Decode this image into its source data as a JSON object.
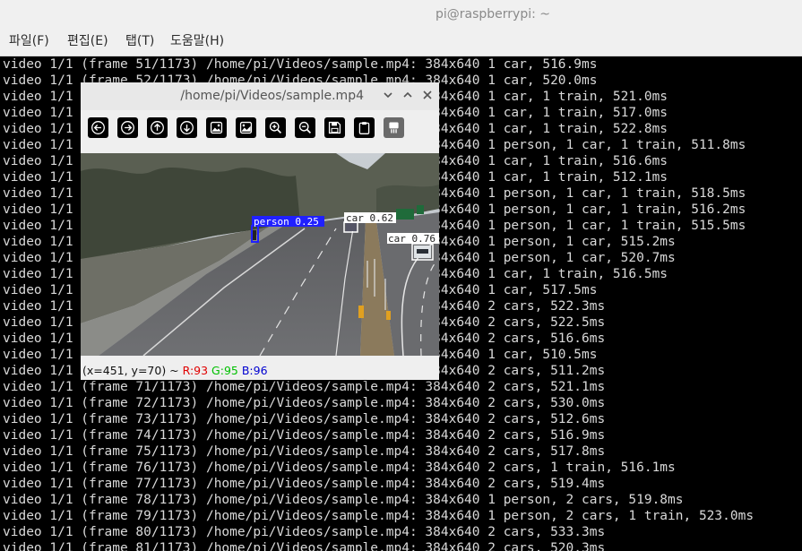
{
  "window": {
    "title": "pi@raspberrypi: ~"
  },
  "menu": [
    "파일(F)",
    "편집(E)",
    "탭(T)",
    "도움말(H)"
  ],
  "terminal_lines": [
    "video 1/1 (frame 51/1173) /home/pi/Videos/sample.mp4: 384x640 1 car, 516.9ms",
    "video 1/1 (frame 52/1173) /home/pi/Videos/sample.mp4: 384x640 1 car, 520.0ms",
    "video 1/1                                             384x640 1 car, 1 train, 521.0ms",
    "video 1/1                                             384x640 1 car, 1 train, 517.0ms",
    "video 1/1                                             384x640 1 car, 1 train, 522.8ms",
    "video 1/1                                             384x640 1 person, 1 car, 1 train, 511.8ms",
    "video 1/1                                             384x640 1 car, 1 train, 516.6ms",
    "video 1/1                                             384x640 1 car, 1 train, 512.1ms",
    "video 1/1                                             384x640 1 person, 1 car, 1 train, 518.5ms",
    "video 1/1                                             384x640 1 person, 1 car, 1 train, 516.2ms",
    "video 1/1                                             384x640 1 person, 1 car, 1 train, 515.5ms",
    "video 1/1                                             384x640 1 person, 1 car, 515.2ms",
    "video 1/1                                             384x640 1 person, 1 car, 520.7ms",
    "video 1/1                                             384x640 1 car, 1 train, 516.5ms",
    "video 1/1                                             384x640 1 car, 517.5ms",
    "video 1/1                                             384x640 2 cars, 522.3ms",
    "video 1/1                                             384x640 2 cars, 522.5ms",
    "video 1/1                                             384x640 2 cars, 516.6ms",
    "video 1/1                                             384x640 1 car, 510.5ms",
    "video 1/1                                             384x640 2 cars, 511.2ms",
    "video 1/1 (frame 71/1173) /home/pi/Videos/sample.mp4: 384x640 2 cars, 521.1ms",
    "video 1/1 (frame 72/1173) /home/pi/Videos/sample.mp4: 384x640 2 cars, 530.0ms",
    "video 1/1 (frame 73/1173) /home/pi/Videos/sample.mp4: 384x640 2 cars, 512.6ms",
    "video 1/1 (frame 74/1173) /home/pi/Videos/sample.mp4: 384x640 2 cars, 516.9ms",
    "video 1/1 (frame 75/1173) /home/pi/Videos/sample.mp4: 384x640 2 cars, 517.8ms",
    "video 1/1 (frame 76/1173) /home/pi/Videos/sample.mp4: 384x640 2 cars, 1 train, 516.1ms",
    "video 1/1 (frame 77/1173) /home/pi/Videos/sample.mp4: 384x640 2 cars, 519.4ms",
    "video 1/1 (frame 78/1173) /home/pi/Videos/sample.mp4: 384x640 1 person, 2 cars, 519.8ms",
    "video 1/1 (frame 79/1173) /home/pi/Videos/sample.mp4: 384x640 1 person, 2 cars, 1 train, 523.0ms",
    "video 1/1 (frame 80/1173) /home/pi/Videos/sample.mp4: 384x640 2 cars, 533.3ms",
    "video 1/1 (frame 81/1173) /home/pi/Videos/sample.mp4: 384x640 2 cars, 520.3ms"
  ],
  "viewer": {
    "title": "/home/pi/Videos/sample.mp4",
    "toolbar_icons": [
      "arrow-left-icon",
      "arrow-right-icon",
      "arrow-up-icon",
      "arrow-down-icon",
      "image-icon",
      "image-settings-icon",
      "zoom-in-icon",
      "zoom-out-icon",
      "save-icon",
      "clipboard-icon",
      "properties-icon"
    ],
    "detections": [
      {
        "label": "person 0.25",
        "color": "#2020ff"
      },
      {
        "label": "car 0.62",
        "color": "#ffffff"
      },
      {
        "label": "car 0.76",
        "color": "#ffffff"
      }
    ],
    "status": {
      "coords": "(x=451, y=70) ~",
      "r": "R:93",
      "g": "G:95",
      "b": "B:96",
      "r_color": "#e00000",
      "g_color": "#00c000",
      "b_color": "#0000d0"
    }
  }
}
